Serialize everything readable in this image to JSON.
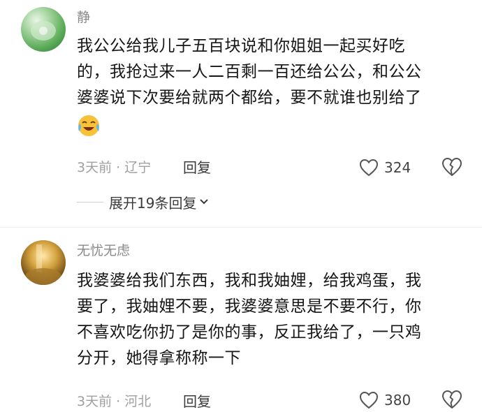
{
  "comments": [
    {
      "username": "静",
      "lines": [
        "我公公给我儿子五百块说和你姐姐一起买好吃",
        "的，我抢过来一人二百剩一百还给公公，和公公",
        "婆婆说下次要给就两个都给，要不就谁也别给了"
      ],
      "emoji": "crying-laughing-emoji",
      "meta": "3天前 · 辽宁",
      "reply_label": "回复",
      "likes": "324",
      "expand_label": "展开19条回复"
    },
    {
      "username": "无忧无虑",
      "lines": [
        "我婆婆给我们东西，我和我妯娌，给我鸡蛋，我",
        "要了，我妯娌不要，我婆婆意思是不要不行，你",
        "不喜欢吃你扔了是你的事，反正我给了，一只鸡",
        "分开，她得拿称称一下"
      ],
      "meta": "3天前 · 河北",
      "reply_label": "回复",
      "likes": "380"
    }
  ],
  "colors": {
    "username": "#8a8a8a",
    "text": "#161616",
    "meta": "#a0a0a0",
    "icon": "#555555"
  }
}
